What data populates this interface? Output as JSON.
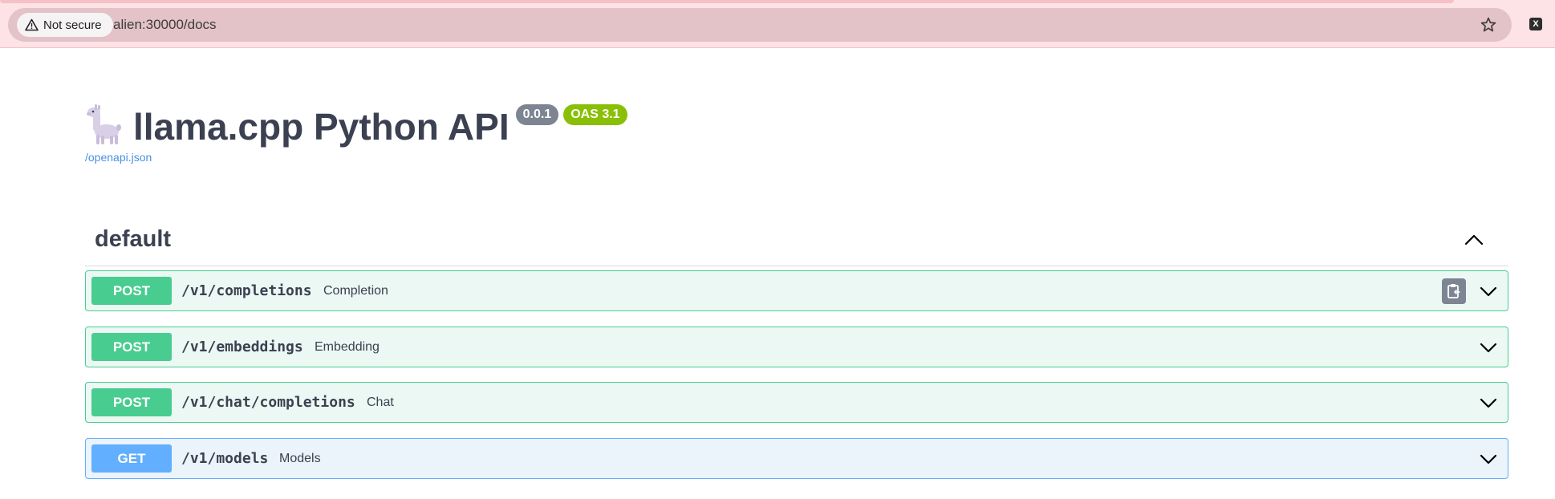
{
  "browser": {
    "security_label": "Not secure",
    "url": "alien:30000/docs",
    "extension_label": "X"
  },
  "info": {
    "title": "llama.cpp Python API",
    "version": "0.0.1",
    "oas": "OAS 3.1",
    "spec_link": "/openapi.json"
  },
  "tag": {
    "name": "default"
  },
  "operations": [
    {
      "method": "POST",
      "path": "/v1/completions",
      "summary": "Completion"
    },
    {
      "method": "POST",
      "path": "/v1/embeddings",
      "summary": "Embedding"
    },
    {
      "method": "POST",
      "path": "/v1/chat/completions",
      "summary": "Chat"
    },
    {
      "method": "GET",
      "path": "/v1/models",
      "summary": "Models"
    }
  ],
  "colors": {
    "post": "#49cc90",
    "get": "#61affe",
    "oas_badge": "#89bf04",
    "version_badge": "#7d8492"
  },
  "icons": [
    "warning-icon",
    "star-icon",
    "llama-icon",
    "chevron-up-icon",
    "copy-icon",
    "chevron-down-icon"
  ]
}
